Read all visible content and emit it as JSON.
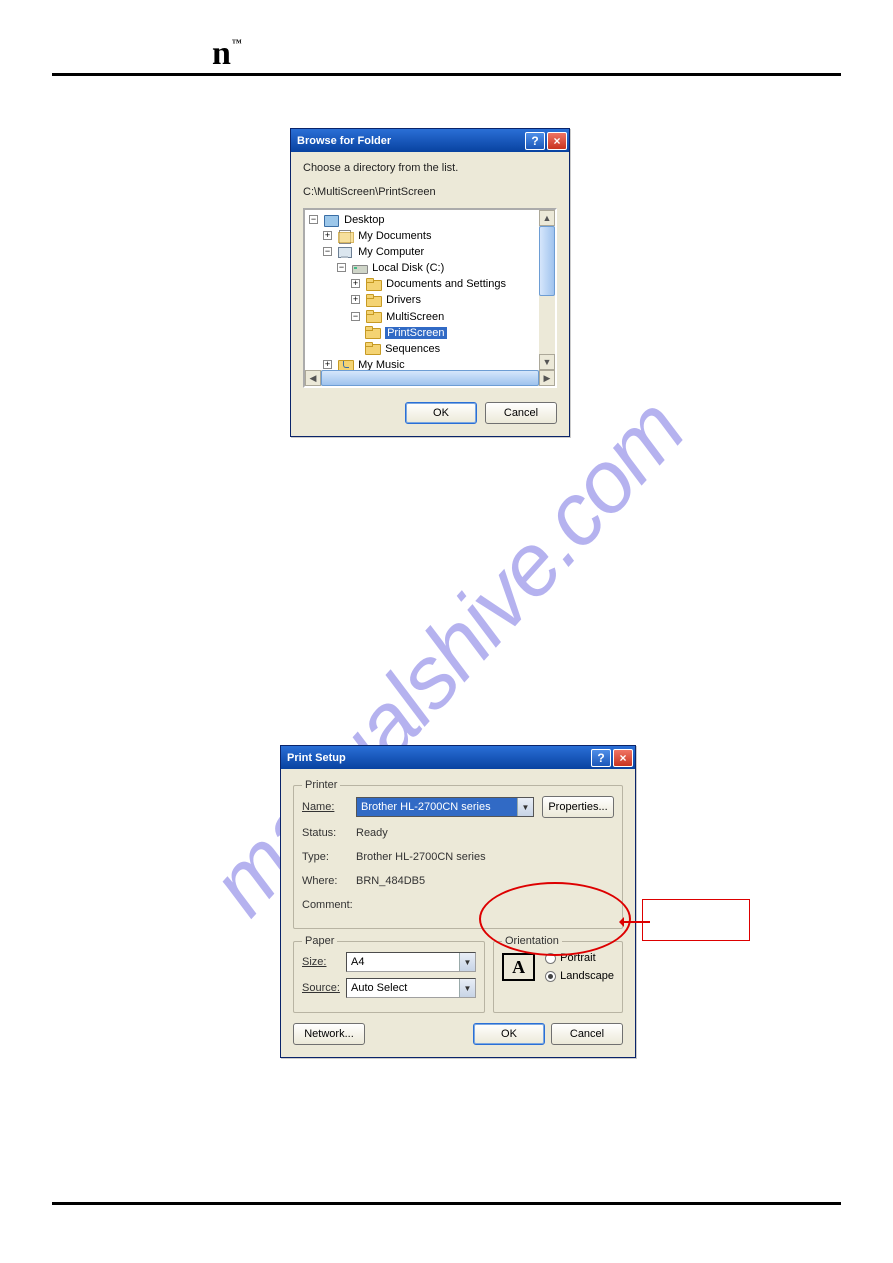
{
  "logo": {
    "letter": "n",
    "tm": "™"
  },
  "watermark": "manualshive.com",
  "dlg1": {
    "title": "Browse for Folder",
    "instruction": "Choose a directory from the list.",
    "path": "C:\\MultiScreen\\PrintScreen",
    "tree": {
      "desktop": "Desktop",
      "mydocs": "My Documents",
      "mycomp": "My Computer",
      "drive": "Local Disk (C:)",
      "docset": "Documents and Settings",
      "drivers": "Drivers",
      "multiscreen": "MultiScreen",
      "printscreen": "PrintScreen",
      "sequences": "Sequences",
      "mymusic": "My Music"
    },
    "ok": "OK",
    "cancel": "Cancel"
  },
  "dlg2": {
    "title": "Print Setup",
    "printer_legend": "Printer",
    "name_label": "Name:",
    "name_value": "Brother HL-2700CN series",
    "properties": "Properties...",
    "status_label": "Status:",
    "status_value": "Ready",
    "type_label": "Type:",
    "type_value": "Brother HL-2700CN series",
    "where_label": "Where:",
    "where_value": "BRN_484DB5",
    "comment_label": "Comment:",
    "paper_legend": "Paper",
    "size_label": "Size:",
    "size_value": "A4",
    "source_label": "Source:",
    "source_value": "Auto Select",
    "orient_legend": "Orientation",
    "a_glyph": "A",
    "portrait": "Portrait",
    "landscape": "Landscape",
    "network": "Network...",
    "ok": "OK",
    "cancel": "Cancel"
  }
}
